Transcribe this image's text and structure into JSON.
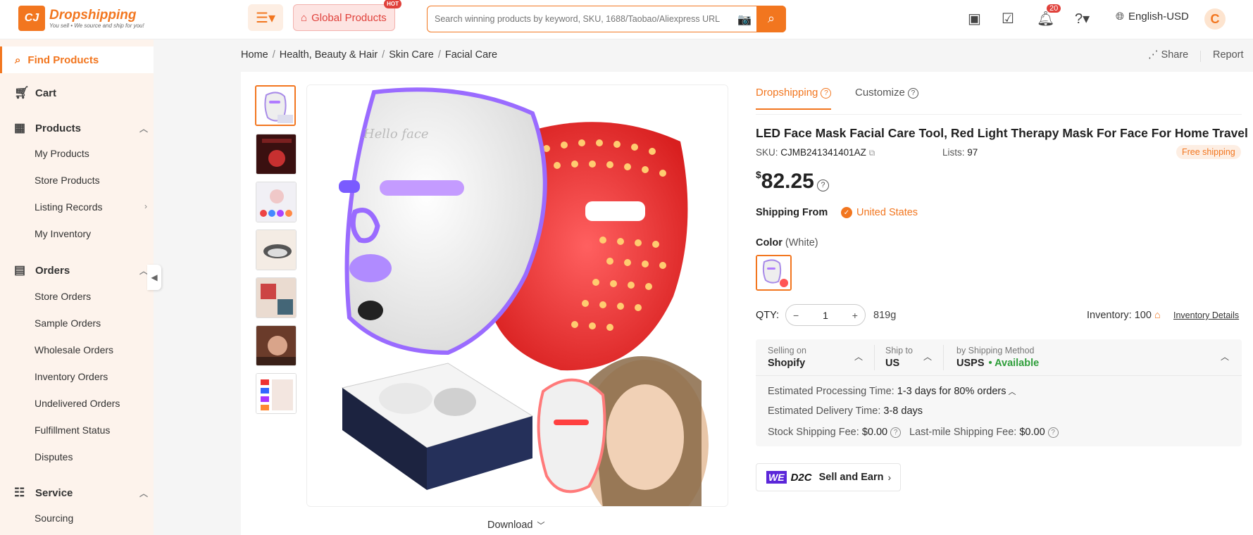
{
  "header": {
    "brand": "Dropshipping",
    "tagline": "You sell • We source and ship for you!",
    "global_products": "Global Products",
    "hot_badge": "HOT",
    "search_placeholder": "Search winning products by keyword, SKU, 1688/Taobao/Aliexpress URL",
    "notification_count": "20",
    "language": "English-USD",
    "avatar_letter": "C"
  },
  "sidebar": {
    "active": "Find Products",
    "cart": "Cart",
    "products": "Products",
    "products_items": [
      "My Products",
      "Store Products",
      "Listing Records",
      "My Inventory"
    ],
    "orders": "Orders",
    "orders_items": [
      "Store Orders",
      "Sample Orders",
      "Wholesale Orders",
      "Inventory Orders",
      "Undelivered Orders",
      "Fulfillment Status",
      "Disputes"
    ],
    "service": "Service",
    "service_items": [
      "Sourcing"
    ]
  },
  "breadcrumb": [
    "Home",
    "Health, Beauty & Hair",
    "Skin Care",
    "Facial Care"
  ],
  "actions": {
    "share": "Share",
    "report": "Report"
  },
  "gallery": {
    "download": "Download"
  },
  "product": {
    "tabs": [
      "Dropshipping",
      "Customize"
    ],
    "title": "LED Face Mask Facial Care Tool, Red Light Therapy Mask For Face For Home Travel",
    "sku_label": "SKU:",
    "sku": "CJMB241341401AZ",
    "lists_label": "Lists:",
    "lists": "97",
    "free_shipping": "Free shipping",
    "currency": "$",
    "price": "82.25",
    "shipping_from_label": "Shipping From",
    "shipping_from": "United States",
    "color_label": "Color",
    "color_value": "(White)",
    "qty_label": "QTY:",
    "qty": "1",
    "weight": "819g",
    "inventory_label": "Inventory:",
    "inventory": "100",
    "inventory_details": "Inventory Details"
  },
  "shipping": {
    "selling_on_label": "Selling on",
    "selling_on": "Shopify",
    "ship_to_label": "Ship to",
    "ship_to": "US",
    "method_label": "by Shipping Method",
    "method": "USPS",
    "available": "• Available",
    "processing_label": "Estimated Processing Time:",
    "processing": "1-3 days for 80% orders",
    "delivery_label": "Estimated Delivery Time:",
    "delivery": "3-8 days",
    "stock_fee_label": "Stock Shipping Fee:",
    "stock_fee": "$0.00",
    "lastmile_label": "Last-mile Shipping Fee:",
    "lastmile": "$0.00"
  },
  "d2c": {
    "we": "WE",
    "d2c": "D2C",
    "sell": "Sell and Earn"
  },
  "colors": {
    "accent": "#f2761f",
    "hot": "#e0413b",
    "available": "#2e9e3a",
    "we_purple": "#5b26d9"
  }
}
